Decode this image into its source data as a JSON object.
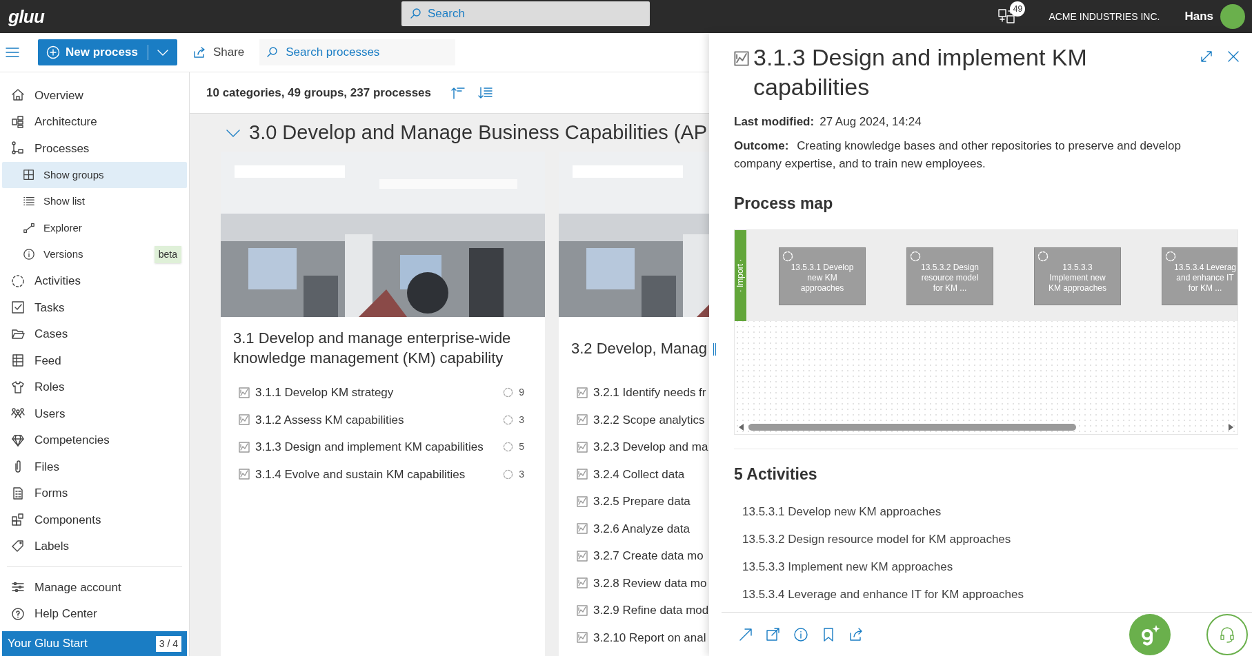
{
  "top_bar": {
    "logo": "gluu",
    "search_placeholder": "Search",
    "notification_count": "49",
    "company": "ACME INDUSTRIES INC.",
    "user": "Hans"
  },
  "toolbar": {
    "new_process": "New process",
    "share": "Share",
    "search_placeholder": "Search processes"
  },
  "sidebar": {
    "items": [
      {
        "label": "Overview",
        "kind": "main",
        "selected": false
      },
      {
        "label": "Architecture",
        "kind": "main",
        "selected": false
      },
      {
        "label": "Processes",
        "kind": "main",
        "selected": false
      },
      {
        "label": "Show groups",
        "kind": "sub",
        "selected": true
      },
      {
        "label": "Show list",
        "kind": "sub",
        "selected": false
      },
      {
        "label": "Explorer",
        "kind": "sub",
        "selected": false
      },
      {
        "label": "Versions",
        "kind": "sub",
        "selected": false,
        "badge": "beta"
      },
      {
        "label": "Activities",
        "kind": "main",
        "selected": false
      },
      {
        "label": "Tasks",
        "kind": "main",
        "selected": false
      },
      {
        "label": "Cases",
        "kind": "main",
        "selected": false
      },
      {
        "label": "Feed",
        "kind": "main",
        "selected": false
      },
      {
        "label": "Roles",
        "kind": "main",
        "selected": false
      },
      {
        "label": "Users",
        "kind": "main",
        "selected": false
      },
      {
        "label": "Competencies",
        "kind": "main",
        "selected": false
      },
      {
        "label": "Files",
        "kind": "main",
        "selected": false
      },
      {
        "label": "Forms",
        "kind": "main",
        "selected": false
      },
      {
        "label": "Components",
        "kind": "main",
        "selected": false
      },
      {
        "label": "Labels",
        "kind": "main",
        "selected": false
      }
    ],
    "footer_items": [
      {
        "label": "Manage account"
      },
      {
        "label": "Help Center"
      }
    ],
    "start": {
      "label": "Your Gluu Start",
      "progress": "3 / 4"
    }
  },
  "summary": "10 categories, 49 groups, 237 processes",
  "category": {
    "title": "3.0 Develop and Manage Business Capabilities (AP",
    "expanded": true
  },
  "groups": [
    {
      "title": "3.1 Develop and manage enterprise-wide knowledge management (KM) capability",
      "processes": [
        {
          "label": "3.1.1 Develop KM strategy",
          "count": "9"
        },
        {
          "label": "3.1.2 Assess KM capabilities",
          "count": "3"
        },
        {
          "label": "3.1.3 Design and implement KM capabilities",
          "count": "5"
        },
        {
          "label": "3.1.4 Evolve and sustain KM capabilities",
          "count": "3"
        }
      ]
    },
    {
      "title": "3.2 Develop, Manag",
      "processes": [
        {
          "label": "3.2.1 Identify needs fr"
        },
        {
          "label": "3.2.2 Scope analytics"
        },
        {
          "label": "3.2.3 Develop and ma"
        },
        {
          "label": "3.2.4 Collect data"
        },
        {
          "label": "3.2.5 Prepare data"
        },
        {
          "label": "3.2.6 Analyze data"
        },
        {
          "label": "3.2.7 Create data mo"
        },
        {
          "label": "3.2.8 Review data mo"
        },
        {
          "label": "3.2.9 Refine data mod"
        },
        {
          "label": "3.2.10 Report on anal"
        }
      ]
    }
  ],
  "detail": {
    "title": "3.1.3 Design and implement KM capabilities",
    "last_modified_label": "Last modified:",
    "last_modified": "27 Aug 2024, 14:24",
    "outcome_label": "Outcome:",
    "outcome": "Creating knowledge bases and other repositories to preserve and develop company expertise, and to train new employees.",
    "process_map": {
      "heading": "Process map",
      "lane": "· Import ·",
      "nodes": [
        {
          "label": "13.5.3.1 Develop new KM approaches"
        },
        {
          "label": "13.5.3.2 Design resource model for KM ..."
        },
        {
          "label": "13.5.3.3 Implement new KM approaches"
        },
        {
          "label": "13.5.3.4 Leverag and enhance IT for KM ..."
        }
      ]
    },
    "activities_heading": "5 Activities",
    "activities": [
      "13.5.3.1 Develop new KM approaches",
      "13.5.3.2 Design resource model for KM approaches",
      "13.5.3.3 Implement new KM approaches",
      "13.5.3.4 Leverage and enhance IT for KM approaches"
    ]
  }
}
